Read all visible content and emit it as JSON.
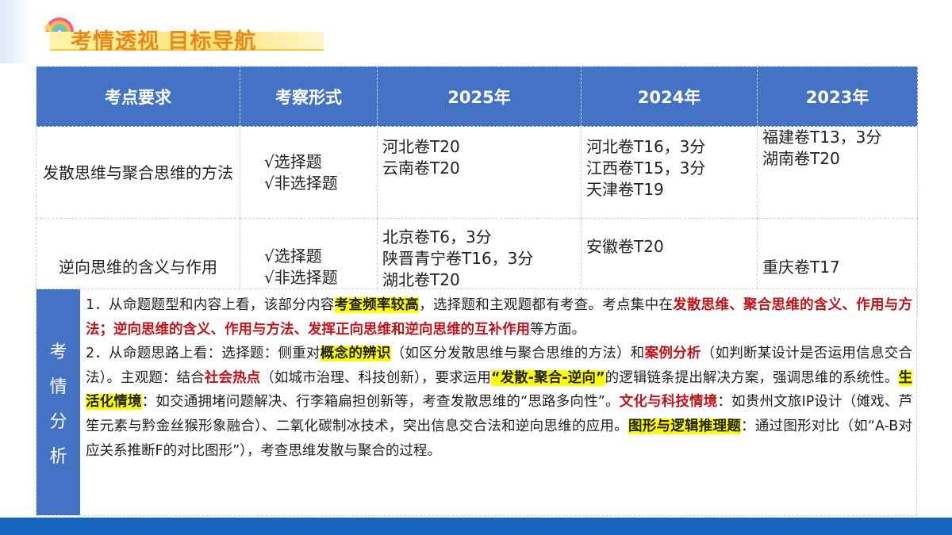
{
  "title": "考情透视 目标导航",
  "colors": {
    "header_bg": "#4472c4",
    "title": "#e8891b",
    "highlight": "#ffff00",
    "red_text": "#c0141b",
    "bottom_bar": "#1565c0"
  },
  "table": {
    "headers": [
      "考点要求",
      "考察形式",
      "2025年",
      "2024年",
      "2023年"
    ],
    "rows": [
      {
        "point": "发散思维与聚合思维的方法",
        "forms": [
          "√选择题",
          "√非选择题"
        ],
        "y2025": [
          "河北卷T20",
          "云南卷T20"
        ],
        "y2024": [
          "河北卷T16，3分",
          "江西卷T15，3分",
          "天津卷T19"
        ],
        "y2023": [
          "福建卷T13，3分",
          "湖南卷T20"
        ]
      },
      {
        "point": "逆向思维的含义与作用",
        "forms": [
          "√选择题",
          "√非选择题"
        ],
        "y2025": [
          "北京卷T6，3分",
          "陕晋青宁卷T16，3分",
          "湖北卷T20"
        ],
        "y2024": [
          "安徽卷T20"
        ],
        "y2023": [
          "重庆卷T17"
        ]
      }
    ]
  },
  "analysis": {
    "label": [
      "考",
      "情",
      "分",
      "析"
    ],
    "p1": {
      "a": "1．从命题题型和内容上看，该部分内容",
      "b": "考查频率较高",
      "c": "，选择题和主观题都有考查。考点集中在",
      "d": "发散思维、聚合思维的含义、作用与方法；逆向思维的含义、作用与方法、发挥正向思维和逆向思维的互补作用",
      "e": "等方面。"
    },
    "p2": {
      "a": "2．从命题思路上看：选择题：侧重对",
      "b": "概念的辨识",
      "c": "（如区分发散思维与聚合思维的方法）和",
      "d": "案例分析",
      "e": "（如判断某设计是否运用信息交合法）。主观题：结合",
      "f": "社会热点",
      "g": "（如城市治理、科技创新），要求运用",
      "h": "“发散-聚合-逆向”",
      "i": "的逻辑链条提出解决方案，强调思维的系统性。",
      "j": "生活化情境",
      "k": "：如交通拥堵问题解决、行李箱扁担创新等，考查发散思维的“思路多向性”。",
      "l": "文化与科技情境",
      "m": "：如贵州文旅IP设计（傩戏、芦笙元素与黔金丝猴形象融合）、二氧化碳制冰技术，突出信息交合法和逆向思维的应用。",
      "n": "图形与逻辑推理题",
      "o": "：通过图形对比（如“A-B对应关系推断F的对比图形”），考查思维发散与聚合的过程。"
    }
  }
}
